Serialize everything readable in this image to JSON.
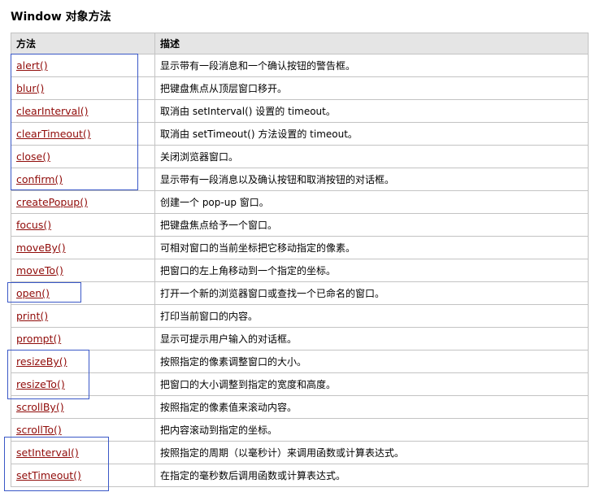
{
  "title": "Window 对象方法",
  "table": {
    "headers": [
      "方法",
      "描述"
    ],
    "rows": [
      {
        "method": "alert()",
        "desc": "显示带有一段消息和一个确认按钮的警告框。"
      },
      {
        "method": "blur()",
        "desc": "把键盘焦点从顶层窗口移开。"
      },
      {
        "method": "clearInterval()",
        "desc": "取消由 setInterval() 设置的 timeout。"
      },
      {
        "method": "clearTimeout()",
        "desc": "取消由 setTimeout() 方法设置的 timeout。"
      },
      {
        "method": "close()",
        "desc": "关闭浏览器窗口。"
      },
      {
        "method": "confirm()",
        "desc": "显示带有一段消息以及确认按钮和取消按钮的对话框。"
      },
      {
        "method": "createPopup()",
        "desc": "创建一个 pop-up 窗口。"
      },
      {
        "method": "focus()",
        "desc": "把键盘焦点给予一个窗口。"
      },
      {
        "method": "moveBy()",
        "desc": "可相对窗口的当前坐标把它移动指定的像素。"
      },
      {
        "method": "moveTo()",
        "desc": "把窗口的左上角移动到一个指定的坐标。"
      },
      {
        "method": "open()",
        "desc": "打开一个新的浏览器窗口或查找一个已命名的窗口。"
      },
      {
        "method": "print()",
        "desc": "打印当前窗口的内容。"
      },
      {
        "method": "prompt()",
        "desc": "显示可提示用户输入的对话框。"
      },
      {
        "method": "resizeBy()",
        "desc": "按照指定的像素调整窗口的大小。"
      },
      {
        "method": "resizeTo()",
        "desc": "把窗口的大小调整到指定的宽度和高度。"
      },
      {
        "method": "scrollBy()",
        "desc": "按照指定的像素值来滚动内容。"
      },
      {
        "method": "scrollTo()",
        "desc": "把内容滚动到指定的坐标。"
      },
      {
        "method": "setInterval()",
        "desc": "按照指定的周期（以毫秒计）来调用函数或计算表达式。"
      },
      {
        "method": "setTimeout()",
        "desc": "在指定的毫秒数后调用函数或计算表达式。"
      }
    ]
  },
  "colors": {
    "link": "#900b09",
    "header_bg": "#e5e5e5",
    "border": "#c3c3c3",
    "highlight": "#3a58c7"
  }
}
